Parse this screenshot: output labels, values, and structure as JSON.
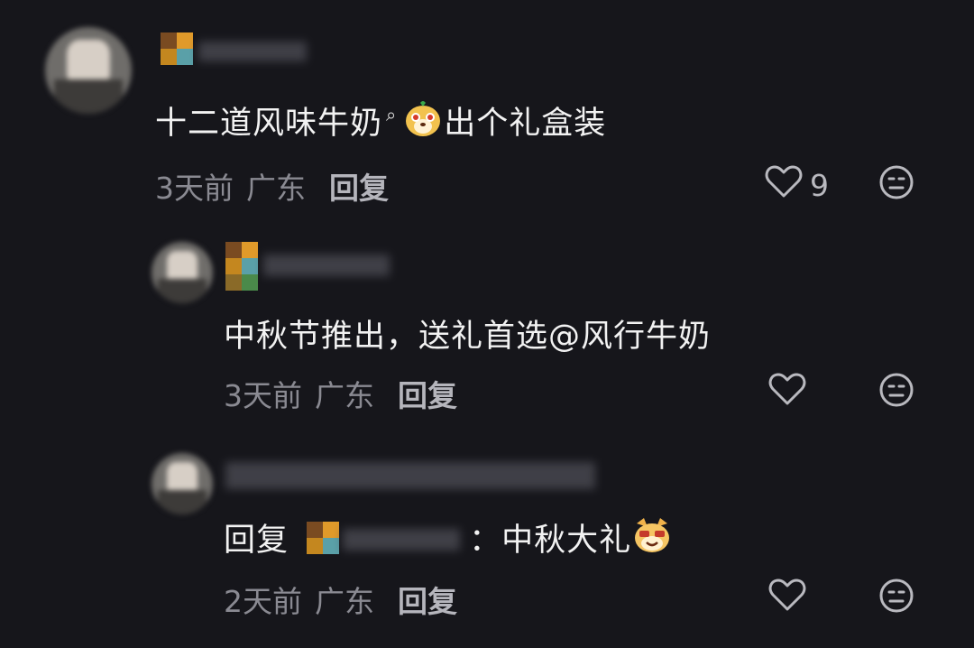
{
  "comments": [
    {
      "text_before": "十二道风味牛奶",
      "text_after": "出个礼盒装",
      "time": "3天前",
      "region": "广东",
      "reply_label": "回复",
      "like_count": "9"
    },
    {
      "text": "中秋节推出，送礼首选@风行牛奶",
      "time": "3天前",
      "region": "广东",
      "reply_label": "回复"
    },
    {
      "reply_prefix": "回复",
      "text": "：中秋大礼",
      "time": "2天前",
      "region": "广东",
      "reply_label": "回复"
    }
  ],
  "icons": [
    "search-icon",
    "heart-icon",
    "emoji-face-icon",
    "dog-emoji-icon",
    "cat-emoji-icon"
  ],
  "colors": {
    "background": "#16161b",
    "text": "#f2f2f2",
    "meta": "#8a8a92",
    "icon": "#b9b9bf"
  }
}
